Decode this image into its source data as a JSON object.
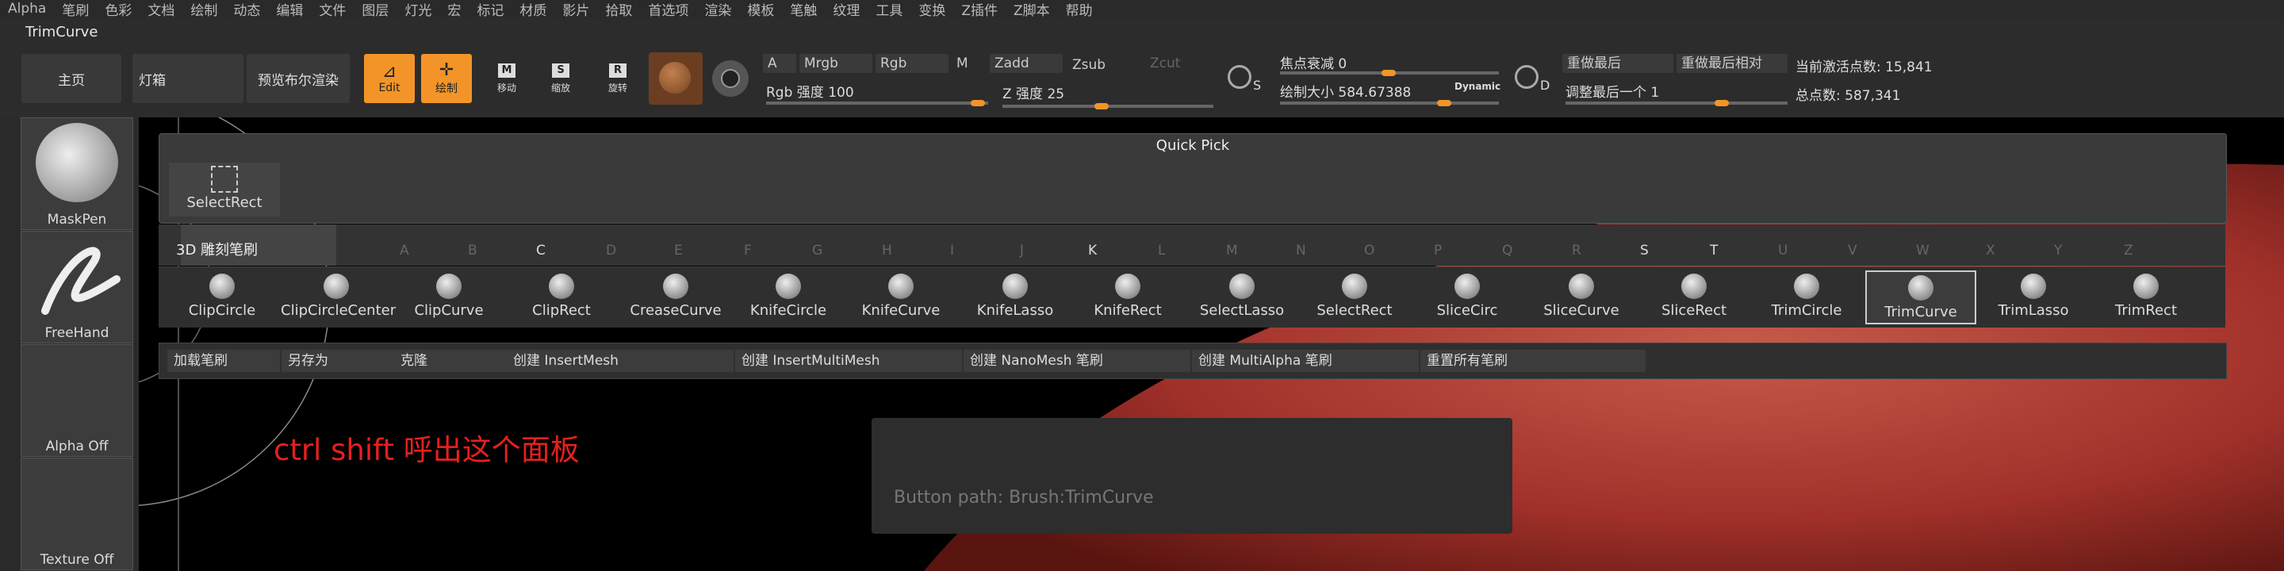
{
  "menu": [
    "Alpha",
    "笔刷",
    "色彩",
    "文档",
    "绘制",
    "动态",
    "编辑",
    "文件",
    "图层",
    "灯光",
    "宏",
    "标记",
    "材质",
    "影片",
    "拾取",
    "首选项",
    "渲染",
    "模板",
    "笔触",
    "纹理",
    "工具",
    "变换",
    "Z插件",
    "Z脚本",
    "帮助"
  ],
  "title": "TrimCurve",
  "toolbar": {
    "home": "主页",
    "lightbox": "灯箱",
    "preview": "预览布尔渲染",
    "edit": "Edit",
    "draw": "绘制",
    "move": "移动",
    "scale": "缩放",
    "rotate": "旋转",
    "move_key": "M",
    "scale_key": "S",
    "rotate_key": "R",
    "a": "A",
    "mrgb": "Mrgb",
    "rgb": "Rgb",
    "m": "M",
    "zadd": "Zadd",
    "zsub": "Zsub",
    "zcut": "Zcut",
    "rgb_intensity": "Rgb 强度 100",
    "z_intensity": "Z 强度 25",
    "s_key": "S",
    "d_key": "D",
    "focal": "焦点衰减 0",
    "draw_size": "绘制大小 584.67388",
    "dynamic": "Dynamic",
    "redo_last": "重做最后",
    "redo_last_rel": "重做最后相对",
    "adjust_last": "调整最后一个 1",
    "active_points": "当前激活点数: 15,841",
    "total_points": "总点数: 587,341"
  },
  "leftpanel": {
    "maskpen": "MaskPen",
    "freehand": "FreeHand",
    "alpha_off": "Alpha Off",
    "texture_off": "Texture Off"
  },
  "quickpick": {
    "title": "Quick Pick",
    "item": "SelectRect"
  },
  "category": "3D 雕刻笔刷",
  "letters": [
    "A",
    "B",
    "C",
    "D",
    "E",
    "F",
    "G",
    "H",
    "I",
    "J",
    "K",
    "L",
    "M",
    "N",
    "O",
    "P",
    "Q",
    "R",
    "S",
    "T",
    "U",
    "V",
    "W",
    "X",
    "Y",
    "Z"
  ],
  "brushes": [
    "ClipCircle",
    "ClipCircleCenter",
    "ClipCurve",
    "ClipRect",
    "CreaseCurve",
    "KnifeCircle",
    "KnifeCurve",
    "KnifeLasso",
    "KnifeRect",
    "SelectLasso",
    "SelectRect",
    "SliceCirc",
    "SliceCurve",
    "SliceRect",
    "TrimCircle",
    "TrimCurve",
    "TrimLasso",
    "TrimRect"
  ],
  "selected_brush": "TrimCurve",
  "actions": [
    "加载笔刷",
    "另存为",
    "克隆",
    "创建 InsertMesh",
    "创建 InsertMultiMesh",
    "创建 NanoMesh 笔刷",
    "创建 MultiAlpha 笔刷",
    "重置所有笔刷"
  ],
  "tooltip": "Button path: Brush:TrimCurve",
  "annotation": "ctrl shift 呼出这个面板",
  "colors": {
    "accent": "#f39428",
    "annotation": "#e5201e",
    "mesh": "#b23a2c"
  }
}
